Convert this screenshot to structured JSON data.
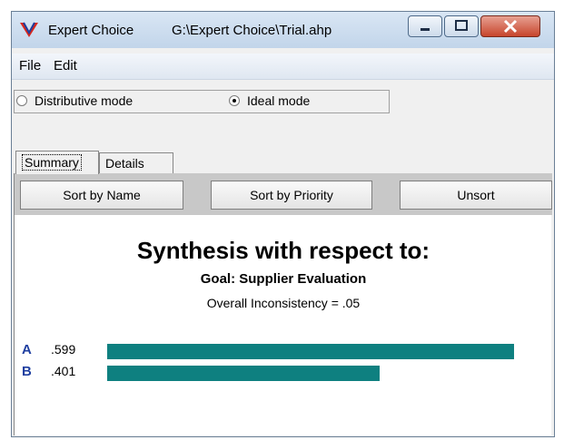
{
  "window": {
    "app_name": "Expert Choice",
    "file_path": "G:\\Expert Choice\\Trial.ahp"
  },
  "menu": [
    "File",
    "Edit"
  ],
  "modes": [
    {
      "label": "Distributive mode",
      "checked": false
    },
    {
      "label": "Ideal mode",
      "checked": true
    }
  ],
  "tabs": [
    {
      "label": "Summary",
      "active": true
    },
    {
      "label": "Details",
      "active": false
    }
  ],
  "sort_buttons": [
    "Sort by Name",
    "Sort by Priority",
    "Unsort"
  ],
  "synthesis": {
    "title": "Synthesis with respect to:",
    "goal": "Goal: Supplier Evaluation",
    "inconsistency": "Overall Inconsistency = .05"
  },
  "chart_data": {
    "type": "bar",
    "categories": [
      "A",
      "B"
    ],
    "values": [
      0.599,
      0.401
    ],
    "value_labels": [
      ".599",
      ".401"
    ],
    "bar_color": "#0e8080"
  }
}
